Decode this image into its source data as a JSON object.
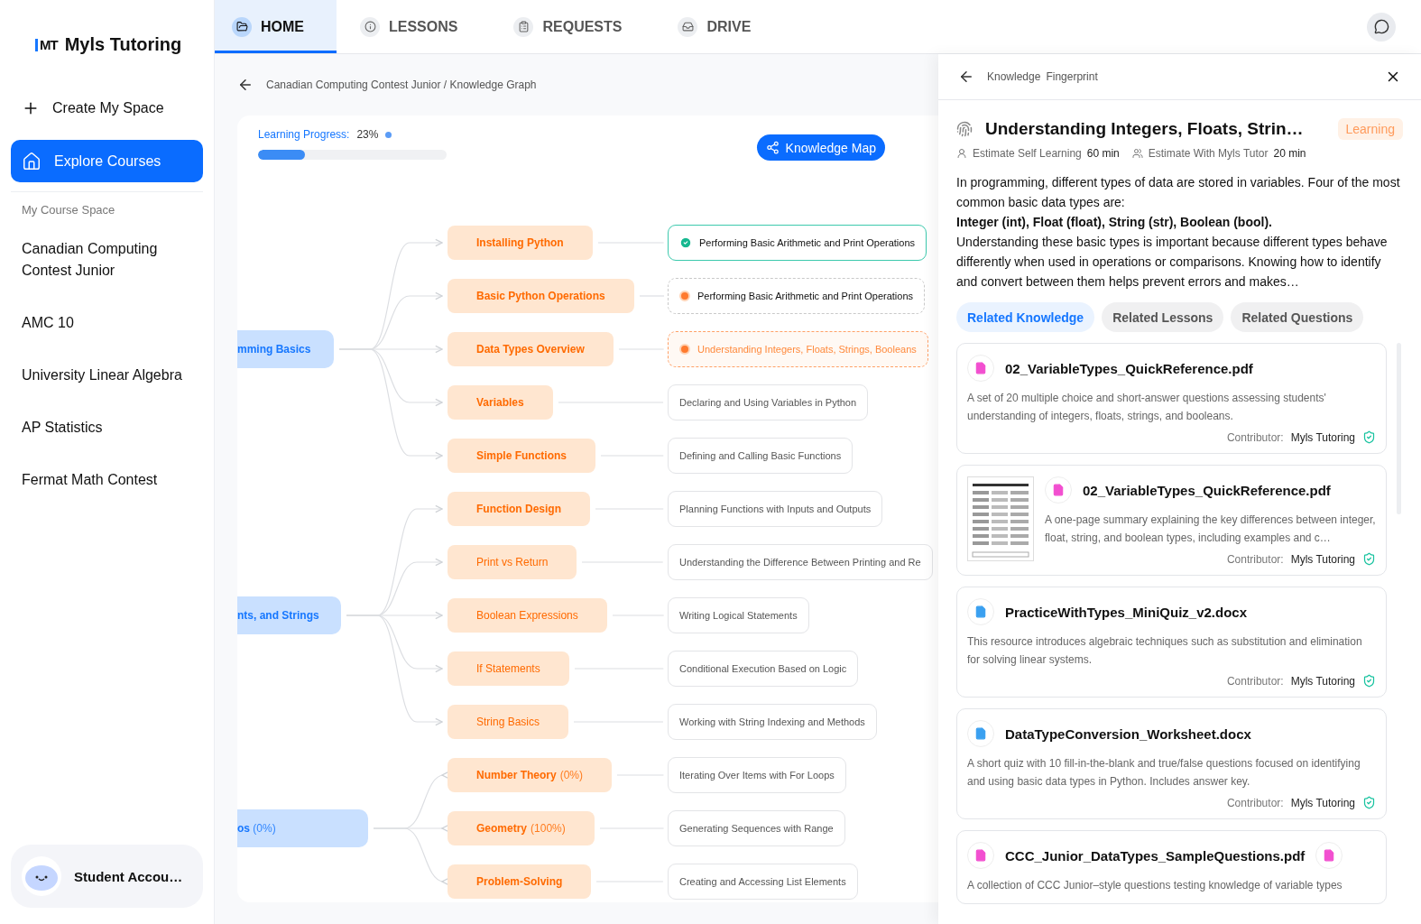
{
  "sidebar": {
    "logo_mark": "MT",
    "logo_text": "Myls Tutoring",
    "create_label": "Create My Space",
    "nav": [
      {
        "label": "Explore Courses",
        "selected": true
      }
    ],
    "section_title": "My Course Space",
    "courses": [
      "Canadian Computing Contest Junior",
      "AMC 10",
      "University Linear Algebra",
      "AP Statistics",
      "Fermat Math Contest"
    ],
    "account": {
      "name": "Student Accou…"
    }
  },
  "tabs": [
    {
      "label": "HOME",
      "selected": true
    },
    {
      "label": "LESSONS",
      "selected": false
    },
    {
      "label": "REQUESTS",
      "selected": false
    },
    {
      "label": "DRIVE",
      "selected": false
    }
  ],
  "breadcrumb": "Canadian Computing Contest Junior / Knowledge Graph",
  "progress": {
    "label": "Learning Progress:",
    "value": "23%",
    "level": 0.25
  },
  "knowledge_map_button": "Knowledge Map",
  "graph": {
    "groups": [
      {
        "root": {
          "label": "mming Basics"
        },
        "topics": [
          {
            "label": "Installing Python",
            "emphasis": true,
            "skill": {
              "label": "Performing Basic Arithmetic and Print Operations",
              "kind": "done",
              "selected": false
            }
          },
          {
            "label": "Basic Python Operations",
            "emphasis": true,
            "skill": {
              "label": "Performing Basic Arithmetic and Print Operations",
              "kind": "learning",
              "selected": false
            }
          },
          {
            "label": "Data Types Overview",
            "emphasis": true,
            "skill": {
              "label": "Understanding Integers, Floats, Strings, Booleans",
              "kind": "learning",
              "selected": true
            }
          },
          {
            "label": "Variables",
            "emphasis": true,
            "skill": {
              "label": "Declaring and Using Variables in Python",
              "kind": "plain",
              "selected": false
            }
          },
          {
            "label": "Simple Functions",
            "emphasis": true,
            "skill": {
              "label": "Defining and Calling Basic Functions",
              "kind": "plain",
              "selected": false
            }
          }
        ]
      },
      {
        "root": {
          "label": "nts, and Strings"
        },
        "topics": [
          {
            "label": "Function Design",
            "emphasis": true,
            "skill": {
              "label": "Planning Functions with Inputs and Outputs",
              "kind": "plain",
              "selected": false
            }
          },
          {
            "label": "Print vs Return",
            "emphasis": false,
            "skill": {
              "label": "Understanding the Difference Between Printing and Re",
              "kind": "plain",
              "selected": false
            }
          },
          {
            "label": "Boolean Expressions",
            "emphasis": false,
            "skill": {
              "label": "Writing Logical Statements",
              "kind": "plain",
              "selected": false
            }
          },
          {
            "label": "If Statements",
            "emphasis": false,
            "skill": {
              "label": "Conditional Execution Based on Logic",
              "kind": "plain",
              "selected": false
            }
          },
          {
            "label": "String Basics",
            "emphasis": false,
            "skill": {
              "label": "Working with String Indexing and Methods",
              "kind": "plain",
              "selected": false
            }
          }
        ]
      },
      {
        "root": {
          "label": "os",
          "percent": "(0%)"
        },
        "topics": [
          {
            "label": "Number Theory",
            "percent": "(0%)",
            "emphasis": true,
            "skill": {
              "label": "Iterating Over Items with For Loops",
              "kind": "plain",
              "selected": false
            }
          },
          {
            "label": "Geometry",
            "percent": "(100%)",
            "emphasis": true,
            "skill": {
              "label": "Generating Sequences with Range",
              "kind": "plain",
              "selected": false
            }
          },
          {
            "label": "Problem-Solving",
            "emphasis": true,
            "skill": {
              "label": "Creating and Accessing List Elements",
              "kind": "plain",
              "selected": false
            }
          }
        ]
      }
    ]
  },
  "panel": {
    "breadcrumb": [
      "Knowledge",
      "Fingerprint"
    ],
    "title": "Understanding Integers, Floats, Strin…",
    "status": "Learning",
    "estimates": [
      {
        "label": "Estimate Self Learning",
        "value": "60 min"
      },
      {
        "label": "Estimate With Myls Tutor",
        "value": "20 min"
      }
    ],
    "description": "In programming, different types of data are stored in variables. Four of the most common basic data types are:\n**Integer (int), Float (float), String (str), Boolean (bool).**\nUnderstanding these basic types is important because different types behave differently when used in operations or comparisons. Knowing how to identify and convert between them helps prevent errors and makes…",
    "tabs": [
      {
        "label": "Related Knowledge",
        "selected": true
      },
      {
        "label": "Related Lessons",
        "selected": false
      },
      {
        "label": "Related Questions",
        "selected": false
      }
    ],
    "resources": [
      {
        "kind": "pdf",
        "name": "02_VariableTypes_QuickReference.pdf",
        "description": "A set of 20 multiple choice and short-answer questions assessing students' understanding of integers, floats, strings, and booleans.",
        "contributor_label": "Contributor:",
        "contributor": "Myls Tutoring",
        "verified": true,
        "thumbnail": false,
        "trailing_icon": false
      },
      {
        "kind": "pdf",
        "name": "02_VariableTypes_QuickReference.pdf",
        "description": "A one-page summary explaining the key differences between integer, float, string, and boolean types, including examples and c…",
        "contributor_label": "Contributor:",
        "contributor": "Myls Tutoring",
        "verified": true,
        "thumbnail": true,
        "trailing_icon": false
      },
      {
        "kind": "docx",
        "name": "PracticeWithTypes_MiniQuiz_v2.docx",
        "description": "This resource introduces algebraic techniques such as substitution and elimination for solving linear systems.",
        "contributor_label": "Contributor:",
        "contributor": "Myls Tutoring",
        "verified": true,
        "thumbnail": false,
        "trailing_icon": false
      },
      {
        "kind": "docx",
        "name": "DataTypeConversion_Worksheet.docx",
        "description": "A short quiz with 10 fill-in-the-blank and true/false questions focused on identifying and using basic data types in Python. Includes answer key.",
        "contributor_label": "Contributor:",
        "contributor": "Myls Tutoring",
        "verified": true,
        "thumbnail": false,
        "trailing_icon": false
      },
      {
        "kind": "pdf",
        "name": "CCC_Junior_DataTypes_SampleQuestions.pdf",
        "description": "A collection of CCC Junior–style questions testing knowledge of variable types",
        "thumbnail": false,
        "trailing_icon": true
      }
    ]
  }
}
